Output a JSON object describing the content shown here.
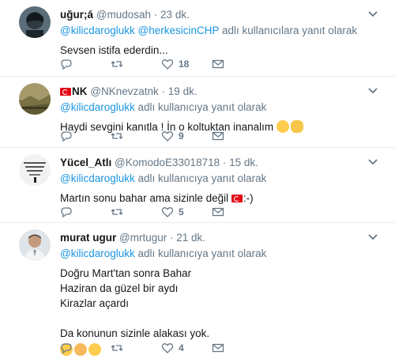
{
  "tweets": [
    {
      "display_name": "uğur;á",
      "handle": "@mudosah",
      "dot": "·",
      "time": "23 dk.",
      "reply_mentions": "@kilicdaroglukk @herkesicinCHP",
      "reply_suffix": " adlı kullanıcılara yanıt olarak",
      "lines": [
        "Sevsen istifa ederdin..."
      ],
      "likes": "18",
      "retweets": "",
      "replies": ""
    },
    {
      "display_name": "NK",
      "handle": "@NKnevzatnk",
      "dot": "·",
      "time": "19 dk.",
      "reply_mentions": "@kilicdaroglukk",
      "reply_suffix": " adlı kullanıcıya yanıt olarak",
      "lines": [
        "Haydi sevgini kanıtla ! İn o koltuktan inanalım"
      ],
      "likes": "9",
      "retweets": "",
      "replies": ""
    },
    {
      "display_name": "Yücel_Atlı",
      "handle": "@KomodoE33018718",
      "dot": "·",
      "time": "15 dk.",
      "reply_mentions": "@kilicdaroglukk",
      "reply_suffix": " adlı kullanıcıya yanıt olarak",
      "lines": [
        "Martın sonu bahar ama sizinle değil",
        ":-)"
      ],
      "likes": "5",
      "retweets": "",
      "replies": ""
    },
    {
      "display_name": "murat ugur",
      "handle": "@mrtugur",
      "dot": "·",
      "time": "21 dk.",
      "reply_mentions": "@kilicdaroglukk",
      "reply_suffix": " adlı kullanıcıya yanıt olarak",
      "lines": [
        "Doğru Mart'tan sonra Bahar",
        "Haziran da güzel bir aydı",
        "Kirazlar açardı",
        "",
        "Da konunun sizinle alakası yok."
      ],
      "likes": "4",
      "retweets": "",
      "replies": ""
    }
  ],
  "colors": {
    "link": "#1b95e0",
    "muted": "#657786",
    "text": "#14171a",
    "divider": "#e6ecf0"
  },
  "icons": [
    "reply-icon",
    "retweet-icon",
    "like-icon",
    "dm-icon",
    "caret-down-icon",
    "turkey-flag-icon"
  ]
}
